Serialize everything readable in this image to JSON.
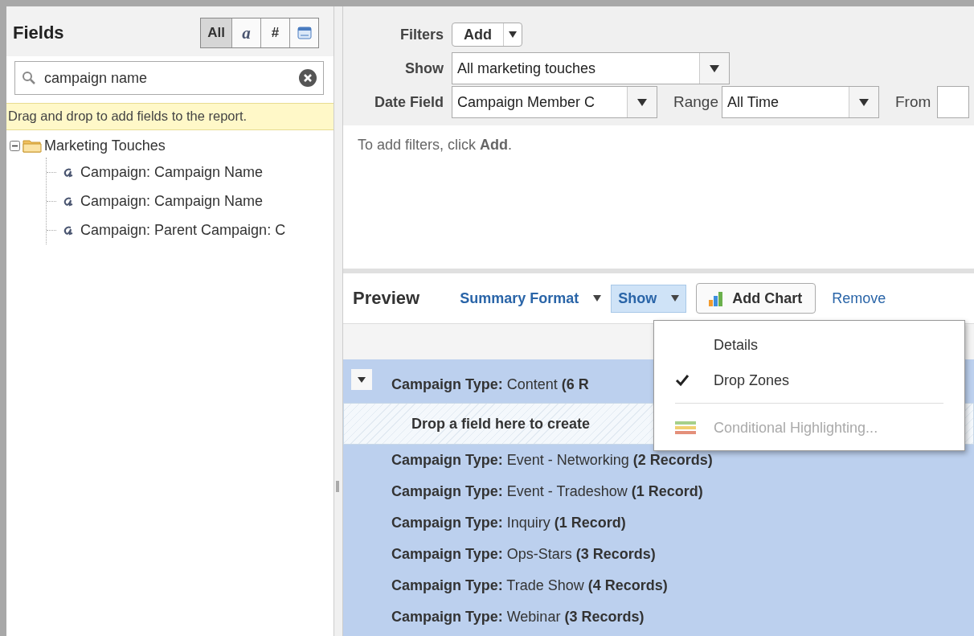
{
  "fields_panel": {
    "title": "Fields",
    "type_filters": [
      {
        "kind": "label",
        "label": "All",
        "selected": true
      },
      {
        "kind": "label",
        "label": "a",
        "selected": false
      },
      {
        "kind": "label",
        "label": "#",
        "selected": false
      },
      {
        "kind": "date",
        "selected": false
      }
    ],
    "search": {
      "value": "campaign name"
    },
    "hint": "Drag and drop to add fields to the report.",
    "tree": [
      {
        "label": "Marketing Touches",
        "expanded": true,
        "children": [
          {
            "label": "Campaign: Campaign Name"
          },
          {
            "label": "Campaign: Campaign Name"
          },
          {
            "label": "Campaign: Parent Campaign: C"
          }
        ]
      }
    ]
  },
  "filters": {
    "filters_label": "Filters",
    "add_button": "Add",
    "show_label": "Show",
    "show_value": "All marketing touches",
    "date_field_label": "Date Field",
    "date_field_value": "Campaign Member C",
    "range_label": "Range",
    "range_value": "All Time",
    "from_label": "From",
    "empty_hint": "To add filters, click **Add**."
  },
  "preview": {
    "title": "Preview",
    "format_menu": "Summary Format",
    "show_menu": {
      "label": "Show",
      "open": true
    },
    "add_chart": "Add Chart",
    "remove_link": "Remove",
    "show_dropdown": [
      {
        "kind": "option",
        "label": "Details",
        "checked": false
      },
      {
        "kind": "option",
        "label": "Drop Zones",
        "checked": true
      },
      {
        "kind": "separator"
      },
      {
        "kind": "action",
        "label": "Conditional Highlighting...",
        "disabled": true
      }
    ],
    "rows": [
      {
        "kind": "group",
        "text": "**Campaign Type:** Content **(6 R**",
        "collapsible": true
      },
      {
        "kind": "drop_zone",
        "text": "Drop a field here to create"
      },
      {
        "kind": "group",
        "text": "**Campaign Type:** Event - Networking **(2 Records)**",
        "collapsible": false
      },
      {
        "kind": "group",
        "text": "**Campaign Type:** Event - Tradeshow **(1 Record)**",
        "collapsible": false
      },
      {
        "kind": "group",
        "text": "**Campaign Type:** Inquiry **(1 Record)**",
        "collapsible": false
      },
      {
        "kind": "group",
        "text": "**Campaign Type:** Ops-Stars **(3 Records)**",
        "collapsible": false
      },
      {
        "kind": "group",
        "text": "**Campaign Type:** Trade Show **(4 Records)**",
        "collapsible": false
      },
      {
        "kind": "group",
        "text": "**Campaign Type:** Webinar **(3 Records)**",
        "collapsible": false
      }
    ]
  }
}
